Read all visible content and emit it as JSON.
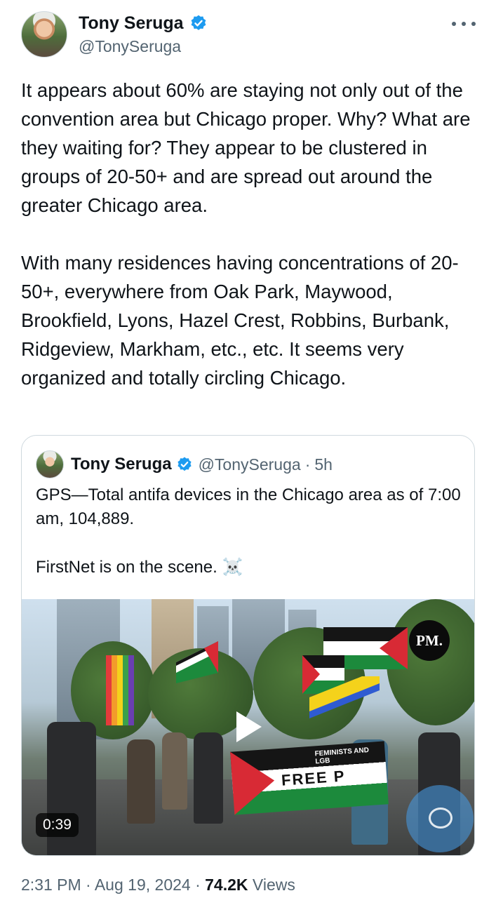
{
  "author": {
    "name": "Tony Seruga",
    "handle": "@TonySeruga"
  },
  "tweet": {
    "text": "It appears about 60% are staying not only out of the convention area but Chicago proper. Why? What are they waiting for? They appear to be clustered in groups of 20-50+ and are spread out around the greater Chicago area.\n\nWith many residences having concentrations of 20-50+, everywhere from Oak Park, Maywood, Brookfield, Lyons, Hazel Crest, Robbins, Burbank, Ridgeview, Markham, etc., etc. It seems very organized and totally circling Chicago."
  },
  "quote": {
    "name": "Tony Seruga",
    "handle": "@TonySeruga",
    "separator": "·",
    "time": "5h",
    "text": "GPS—Total antifa devices in the Chicago area as of 7:00 am, 104,889.\n\nFirstNet is on the scene. ",
    "emoji": "☠️",
    "media": {
      "duration": "0:39",
      "badge": "PM.",
      "banner_text": "FREE P",
      "banner_small": "FEMINISTS AND LGB"
    }
  },
  "meta": {
    "time": "2:31 PM",
    "sep1": "·",
    "date": "Aug 19, 2024",
    "sep2": "·",
    "views_count": "74.2K",
    "views_label": "Views"
  },
  "icons": [
    "verified-badge-icon",
    "more-options-icon",
    "play-icon",
    "reply-icon"
  ],
  "colors": {
    "verified": "#1d9bf0",
    "secondary_text": "#536471",
    "border": "#cfd9de"
  }
}
